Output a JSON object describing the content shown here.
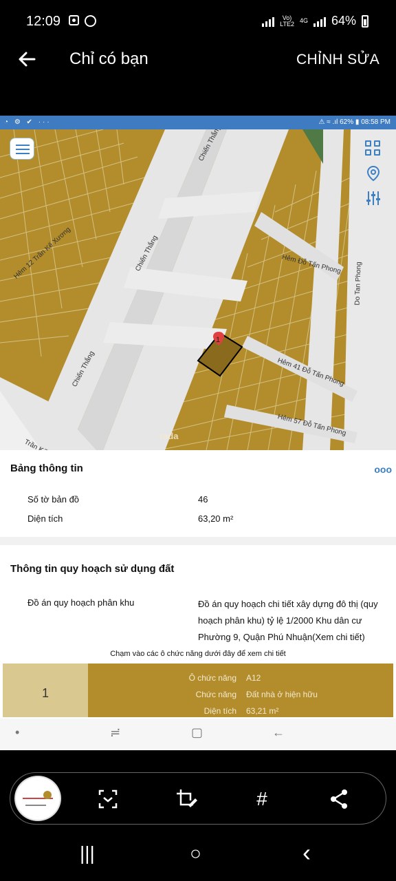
{
  "status_bar": {
    "time": "12:09",
    "network": "VoLTE2",
    "network_type": "4G",
    "battery": "64%"
  },
  "app_bar": {
    "title": "Chỉ có bạn",
    "edit_label": "CHỈNH SỬA",
    "back_icon": "arrow-left-icon"
  },
  "inner_status": {
    "left_icons": "◔ ⚙ ✔ ···",
    "right": "⚠ ≈ .ıl 62% ▮ 08:58 PM"
  },
  "map": {
    "street_labels": [
      "Chiến Thắng",
      "Chiến Thắng",
      "Chiến Thắng",
      "Hẻm 12 Trần Kế Xương",
      "Do Tan Phong",
      "Hẻm 41 Đỗ Tấn Phong",
      "Hẻm 57 Đỗ Tấn Phong",
      "Trần Kế",
      "Hẻm Đỗ Tấn Phong"
    ],
    "parcel_number": "1",
    "watermark": "rada"
  },
  "info": {
    "title": "Bảng thông tin",
    "more": "ooo",
    "rows": [
      {
        "label": "Số tờ bản đồ",
        "value": "46"
      },
      {
        "label": "Diện tích",
        "value": "63,20 m²"
      }
    ]
  },
  "planning": {
    "title": "Thông tin quy hoạch sử dụng đất",
    "label": "Đồ án quy hoạch phân khu",
    "value": "Đồ án quy hoạch chi tiết xây dựng đô thị (quy hoạch phân khu) tỷ lệ 1/2000 Khu dân cư Phường 9, Quận Phú Nhuận(Xem chi tiết)",
    "hint": "Chạm vào các ô chức năng dưới đây để xem chi tiết"
  },
  "zone": {
    "number": "1",
    "rows": [
      {
        "label": "Ô chức năng",
        "value": "A12"
      },
      {
        "label": "Chức năng",
        "value": "Đất nhà ở hiện hữu"
      },
      {
        "label": "Diện tích",
        "value": "63,21 m²"
      }
    ],
    "color": "#b38d2b"
  },
  "inner_nav": {
    "dot": "•",
    "recent": "≓",
    "home": "▢",
    "back": "←"
  },
  "toolbar": {
    "icons": [
      "scan-icon",
      "crop-edit-icon",
      "hashtag-icon",
      "share-icon"
    ],
    "hash": "#"
  },
  "sys_nav": {
    "recent": "|||",
    "home": "○",
    "back": "‹"
  }
}
